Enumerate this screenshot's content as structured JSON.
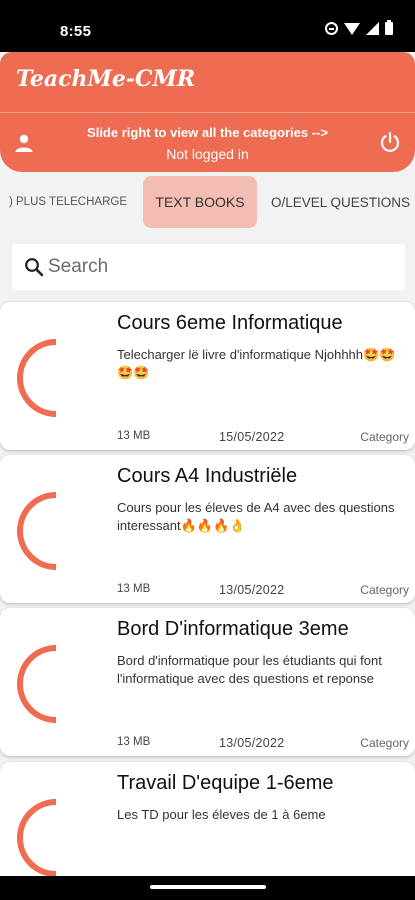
{
  "status_bar": {
    "time": "8:55"
  },
  "app": {
    "title": "TeachMe-CMR"
  },
  "banner": {
    "line1": "Slide right to view all the categories -->",
    "line2": "Not logged in"
  },
  "tabs": [
    {
      "label": ") PLUS TELECHARGE",
      "selected": false
    },
    {
      "label": "TEXT BOOKS",
      "selected": true
    },
    {
      "label": "O/LEVEL QUESTIONS",
      "selected": false
    }
  ],
  "search": {
    "placeholder": "Search",
    "value": ""
  },
  "items": [
    {
      "title": "Cours 6eme Informatique",
      "description": "Telecharger lë livre d'informatique Njohhhh🤩🤩🤩🤩",
      "size": "13 MB",
      "date": "15/05/2022",
      "category": "Category"
    },
    {
      "title": "Cours A4 Industriële",
      "description": "Cours pour les éleves de A4 avec des questions interessant🔥🔥🔥👌",
      "size": "13 MB",
      "date": "13/05/2022",
      "category": "Category"
    },
    {
      "title": "Bord D'informatique 3eme",
      "description": "Bord d'informatique pour les étudiants qui font l'informatique avec des questions et reponse",
      "size": "13 MB",
      "date": "13/05/2022",
      "category": "Category"
    },
    {
      "title": "Travail D'equipe 1-6eme",
      "description": "Les TD pour les éleves de 1 à 6eme",
      "size": "",
      "date": "",
      "category": ""
    }
  ],
  "colors": {
    "accent": "#ee6c52",
    "selected_tab": "#f4bdb4",
    "background": "#f2f2f2"
  },
  "icons": {
    "user": "user-icon",
    "power": "power-icon",
    "search": "search-icon",
    "loading": "loading-spinner-icon"
  }
}
